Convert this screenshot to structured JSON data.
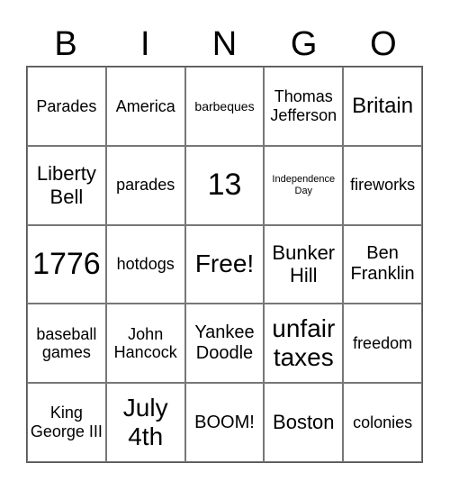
{
  "header": [
    "B",
    "I",
    "N",
    "G",
    "O"
  ],
  "cells": [
    [
      "Parades",
      "America",
      "barbeques",
      "Thomas Jefferson",
      "Britain"
    ],
    [
      "Liberty Bell",
      "parades",
      "13",
      "Independence Day",
      "fireworks"
    ],
    [
      "1776",
      "hotdogs",
      "Free!",
      "Bunker Hill",
      "Ben Franklin"
    ],
    [
      "baseball games",
      "John Hancock",
      "Yankee Doodle",
      "unfair taxes",
      "freedom"
    ],
    [
      "King George III",
      "July 4th",
      "BOOM!",
      "Boston",
      "colonies"
    ]
  ]
}
